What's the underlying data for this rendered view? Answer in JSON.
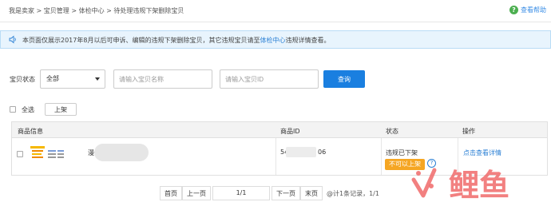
{
  "breadcrumb": {
    "items": [
      "我是卖家",
      "宝贝管理",
      "体检中心",
      "待处理违规下架删除宝贝"
    ],
    "separator": ">"
  },
  "help": {
    "label": "查看帮助"
  },
  "notice": {
    "text_before": "本页面仅展示2017年8月以后可申诉、编辑的违规下架删除宝贝，其它违规宝贝请至",
    "link_text": "体检中心",
    "text_after": "违规详情查看。"
  },
  "filter": {
    "status_label": "宝贝状态",
    "status_value": "全部",
    "name_placeholder": "请输入宝贝名称",
    "id_placeholder": "请输入宝贝ID",
    "query_label": "查询"
  },
  "bulk": {
    "select_all_label": "全选",
    "shelf_label": "上架"
  },
  "table": {
    "headers": [
      "商品信息",
      "商品ID",
      "状态",
      "操作"
    ],
    "rows": [
      {
        "name_prefix": "漫",
        "id_prefix": "54",
        "id_suffix": "06",
        "status": "违规已下架",
        "badge": "不可以上架",
        "action": "点击查看详情"
      }
    ]
  },
  "pager": {
    "first": "首页",
    "prev": "上一页",
    "page": "1/1",
    "next": "下一页",
    "last": "末页",
    "info": "@计1条记录，1/1"
  },
  "colors": {
    "accent": "#1a7fe0",
    "link": "#2a7fd4",
    "badge": "#f5a623",
    "notice_bg": "#e8f4fd",
    "help_icon": "#4caf50"
  },
  "watermark": {
    "brand_text": "鲤鱼"
  }
}
